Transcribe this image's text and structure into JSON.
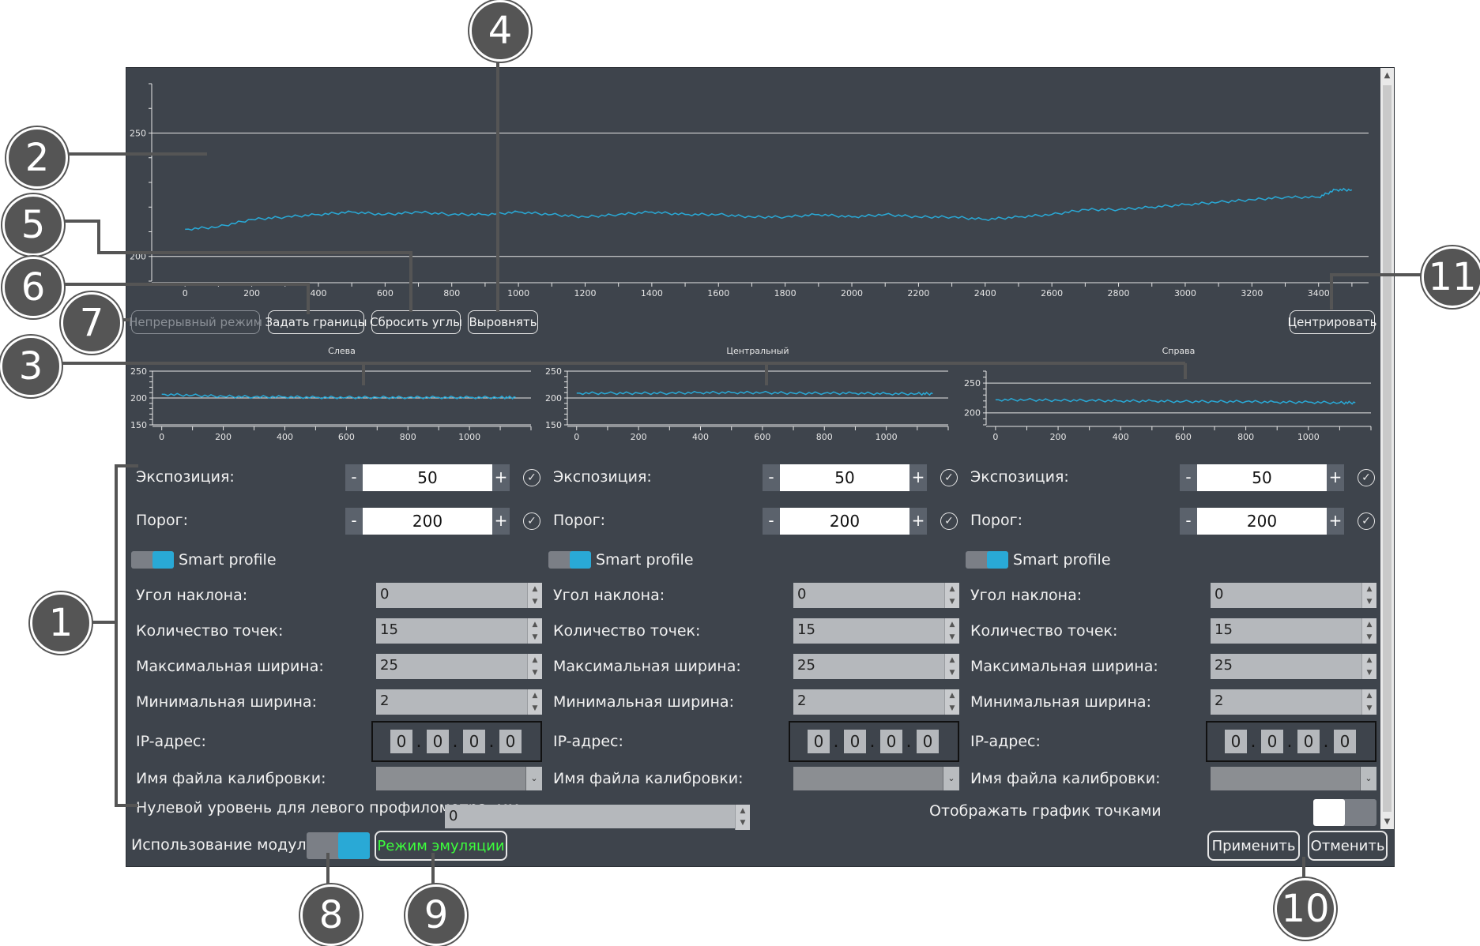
{
  "main_chart": {
    "type": "line",
    "yticks": [
      "250",
      "200"
    ],
    "ylim": [
      190,
      270
    ],
    "xticks": [
      "0",
      "200",
      "400",
      "600",
      "800",
      "1000",
      "1200",
      "1400",
      "1600",
      "1800",
      "2000",
      "2200",
      "2400",
      "2600",
      "2800",
      "3000",
      "3200",
      "3400"
    ],
    "xlim": [
      -100,
      3550
    ],
    "series": [
      {
        "x": [
          0,
          100,
          200,
          300,
          400,
          500,
          600,
          700,
          800,
          900,
          1000,
          1100,
          1200,
          1300,
          1400,
          1500,
          1600,
          1700,
          1800,
          1900,
          2000,
          2100,
          2200,
          2300,
          2400,
          2500,
          2600,
          2700,
          2800,
          2900,
          3000,
          3100,
          3200,
          3300,
          3400,
          3450,
          3500
        ],
        "y": [
          211,
          212,
          215,
          216,
          217,
          218,
          217,
          218,
          217,
          217,
          218,
          217,
          216,
          217,
          218,
          217,
          217,
          216,
          216,
          217,
          216,
          217,
          216,
          216,
          215,
          216,
          217,
          219,
          219,
          220,
          221,
          222,
          223,
          224,
          224,
          227,
          227
        ],
        "color": "#29a9d6"
      }
    ]
  },
  "toolbar": {
    "continuous": "Непрерывный режим",
    "set_bounds": "Задать границы",
    "reset_angles": "Сбросить углы",
    "align": "Выровнять",
    "center": "Центрировать"
  },
  "chart_data": [
    {
      "type": "line",
      "title": "Слева",
      "yticks": [
        "250",
        "200",
        "150"
      ],
      "xticks": [
        "0",
        "200",
        "400",
        "600",
        "800",
        "1000"
      ],
      "ylim": [
        150,
        250
      ],
      "xlim": [
        -30,
        1200
      ],
      "series": [
        {
          "x": [
            0,
            100,
            200,
            300,
            400,
            500,
            600,
            700,
            800,
            900,
            1000,
            1100,
            1150
          ],
          "y": [
            207,
            205,
            203,
            202,
            202,
            201,
            201,
            201,
            201,
            201,
            201,
            201,
            201
          ],
          "color": "#29a9d6"
        }
      ]
    },
    {
      "type": "line",
      "title": "Центральный",
      "yticks": [
        "250",
        "200",
        "150"
      ],
      "xticks": [
        "0",
        "200",
        "400",
        "600",
        "800",
        "1000"
      ],
      "ylim": [
        150,
        250
      ],
      "xlim": [
        -30,
        1200
      ],
      "series": [
        {
          "x": [
            0,
            100,
            200,
            300,
            400,
            500,
            600,
            700,
            800,
            900,
            1000,
            1100,
            1150
          ],
          "y": [
            209,
            209,
            209,
            209,
            210,
            210,
            210,
            209,
            209,
            209,
            208,
            208,
            208
          ],
          "color": "#29a9d6"
        }
      ]
    },
    {
      "type": "line",
      "title": "Справа",
      "yticks": [
        "250",
        "200"
      ],
      "xticks": [
        "0",
        "200",
        "400",
        "600",
        "800",
        "1000"
      ],
      "ylim": [
        180,
        270
      ],
      "xlim": [
        -30,
        1200
      ],
      "series": [
        {
          "x": [
            0,
            100,
            200,
            300,
            400,
            500,
            600,
            700,
            800,
            900,
            1000,
            1100,
            1150
          ],
          "y": [
            222,
            222,
            221,
            221,
            220,
            220,
            219,
            219,
            219,
            218,
            218,
            217,
            217
          ],
          "color": "#29a9d6"
        }
      ]
    }
  ],
  "panels": [
    {
      "exposure_label": "Экспозиция:",
      "exposure_value": "50",
      "threshold_label": "Порог:",
      "threshold_value": "200",
      "minus": "-",
      "plus": "+",
      "check": "✓",
      "smart_label": "Smart profile",
      "tilt_label": "Угол наклона:",
      "tilt_value": "0",
      "points_label": "Количество точек:",
      "points_value": "15",
      "max_width_label": "Максимальная ширина:",
      "max_width_value": "25",
      "min_width_label": "Минимальная ширина:",
      "min_width_value": "2",
      "ip_label": "IP-адрес:",
      "ip": [
        "0",
        "0",
        "0",
        "0"
      ],
      "calib_label": "Имя файла калибровки:"
    },
    {
      "exposure_label": "Экспозиция:",
      "exposure_value": "50",
      "threshold_label": "Порог:",
      "threshold_value": "200",
      "minus": "-",
      "plus": "+",
      "check": "✓",
      "smart_label": "Smart profile",
      "tilt_label": "Угол наклона:",
      "tilt_value": "0",
      "points_label": "Количество точек:",
      "points_value": "15",
      "max_width_label": "Максимальная ширина:",
      "max_width_value": "25",
      "min_width_label": "Минимальная ширина:",
      "min_width_value": "2",
      "ip_label": "IP-адрес:",
      "ip": [
        "0",
        "0",
        "0",
        "0"
      ],
      "calib_label": "Имя файла калибровки:"
    },
    {
      "exposure_label": "Экспозиция:",
      "exposure_value": "50",
      "threshold_label": "Порог:",
      "threshold_value": "200",
      "minus": "-",
      "plus": "+",
      "check": "✓",
      "smart_label": "Smart profile",
      "tilt_label": "Угол наклона:",
      "tilt_value": "0",
      "points_label": "Количество точек:",
      "points_value": "15",
      "max_width_label": "Максимальная ширина:",
      "max_width_value": "25",
      "min_width_label": "Минимальная ширина:",
      "min_width_value": "2",
      "ip_label": "IP-адрес:",
      "ip": [
        "0",
        "0",
        "0",
        "0"
      ],
      "calib_label": "Имя файла калибровки:"
    }
  ],
  "zero_level": {
    "label": "Нулевой уровень для левого профилометра, мм:",
    "value": "0"
  },
  "dots_option": {
    "label": "Отображать график точками"
  },
  "footer": {
    "module_label": "Использование модуля",
    "emulation": "Режим эмуляции",
    "apply": "Применить",
    "cancel": "Отменить"
  },
  "callouts": [
    "1",
    "2",
    "3",
    "4",
    "5",
    "6",
    "7",
    "8",
    "9",
    "10",
    "11"
  ],
  "icons": {
    "checkmark": "✓",
    "spin_up": "▲",
    "spin_down": "▼",
    "dropdown": "⌄"
  }
}
